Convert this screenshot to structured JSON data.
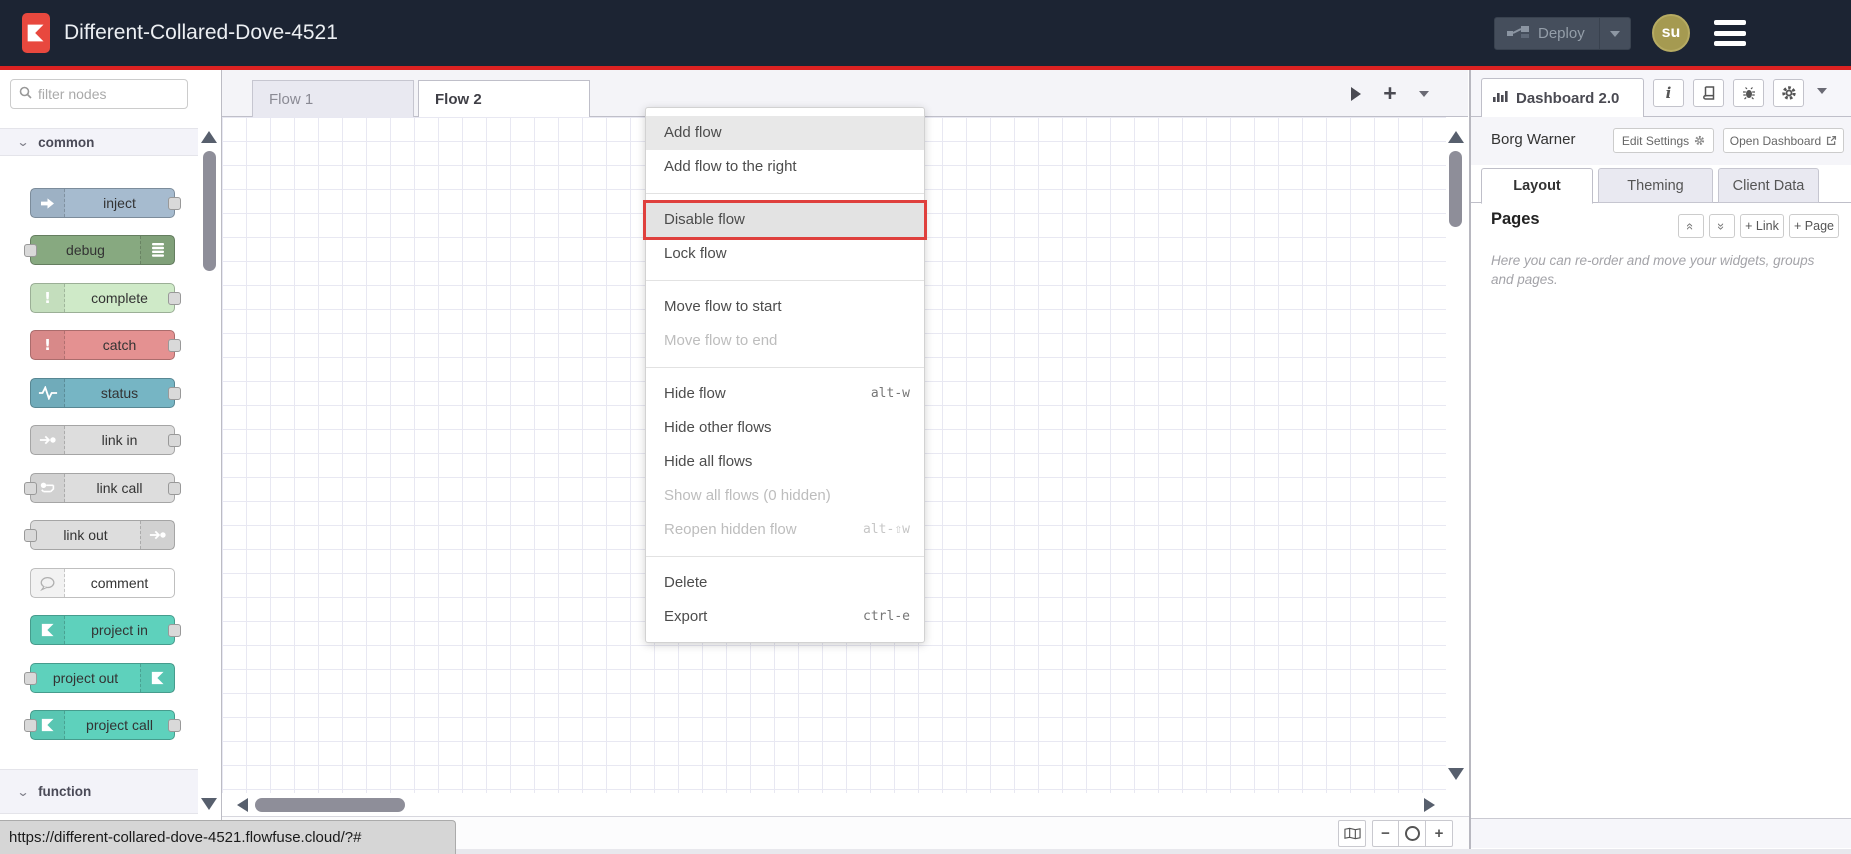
{
  "header": {
    "title": "Different-Collared-Dove-4521",
    "deploy_label": "Deploy",
    "avatar_initials": "su"
  },
  "palette": {
    "filter_placeholder": "filter nodes",
    "category_common": "common",
    "category_function": "function",
    "nodes": [
      {
        "label": "inject",
        "color": "#a6bbcf"
      },
      {
        "label": "debug",
        "color": "#87a980"
      },
      {
        "label": "complete",
        "color": "#cfeac8"
      },
      {
        "label": "catch",
        "color": "#e49191"
      },
      {
        "label": "status",
        "color": "#76b5c4"
      },
      {
        "label": "link in",
        "color": "#dddddd"
      },
      {
        "label": "link call",
        "color": "#dddddd"
      },
      {
        "label": "link out",
        "color": "#dddddd"
      },
      {
        "label": "comment",
        "color": "#ffffff"
      },
      {
        "label": "project in",
        "color": "#5ed1bc"
      },
      {
        "label": "project out",
        "color": "#5ed1bc"
      },
      {
        "label": "project call",
        "color": "#5ed1bc"
      }
    ]
  },
  "tabs": {
    "flow1": "Flow 1",
    "flow2": "Flow 2"
  },
  "context_menu": {
    "items": [
      {
        "label": "Add flow",
        "shortcut": ""
      },
      {
        "label": "Add flow to the right",
        "shortcut": ""
      },
      {
        "label": "Disable flow",
        "shortcut": ""
      },
      {
        "label": "Lock flow",
        "shortcut": ""
      },
      {
        "label": "Move flow to start",
        "shortcut": ""
      },
      {
        "label": "Move flow to end",
        "shortcut": ""
      },
      {
        "label": "Hide flow",
        "shortcut": "alt-w"
      },
      {
        "label": "Hide other flows",
        "shortcut": ""
      },
      {
        "label": "Hide all flows",
        "shortcut": ""
      },
      {
        "label": "Show all flows (0 hidden)",
        "shortcut": ""
      },
      {
        "label": "Reopen hidden flow",
        "shortcut": "alt-⇧w"
      },
      {
        "label": "Delete",
        "shortcut": ""
      },
      {
        "label": "Export",
        "shortcut": "ctrl-e"
      }
    ]
  },
  "sidebar": {
    "panel_tab": "Dashboard 2.0",
    "instance_name": "Borg Warner",
    "edit_settings_label": "Edit Settings",
    "open_dashboard_label": "Open Dashboard",
    "tabs": [
      {
        "label": "Layout"
      },
      {
        "label": "Theming"
      },
      {
        "label": "Client Data"
      }
    ],
    "pages_title": "Pages",
    "link_button": "+ Link",
    "page_button": "+ Page",
    "help_text": "Here you can re-order and move your widgets, groups and pages."
  },
  "statusbar": {
    "url": "https://different-collared-dove-4521.flowfuse.cloud/?#"
  },
  "colors": {
    "header_bg": "#1c2433",
    "accent_red": "#dd2222",
    "logo_red": "#e8483e",
    "annotation_red": "#df403d",
    "avatar_olive": "#a59a51",
    "grid_line": "#e8e8f2"
  }
}
